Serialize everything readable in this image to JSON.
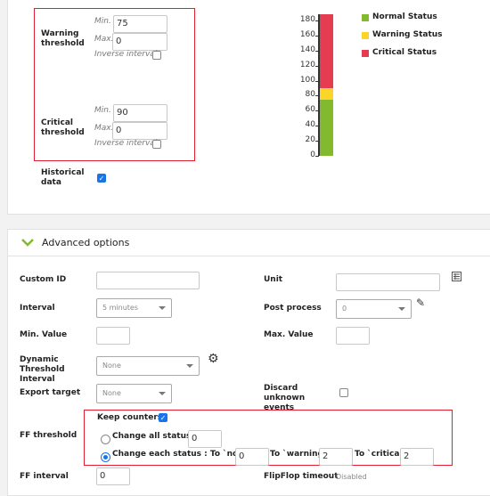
{
  "thresholds": {
    "warning": {
      "label": "Warning threshold",
      "min_label": "Min.",
      "min": "75",
      "max_label": "Max.",
      "max": "0",
      "inverse_label": "Inverse interval",
      "inverse": false
    },
    "critical": {
      "label": "Critical threshold",
      "min_label": "Min.",
      "min": "90",
      "max_label": "Max.",
      "max": "0",
      "inverse_label": "Inverse interval",
      "inverse": false
    },
    "historical_label": "Historical data",
    "historical": true
  },
  "chart_data": {
    "type": "bar",
    "stacked": true,
    "categories": [
      ""
    ],
    "series": [
      {
        "name": "Normal Status",
        "values": [
          75
        ],
        "color": "#82b92e"
      },
      {
        "name": "Warning Status",
        "values": [
          15
        ],
        "color": "#fcd52b"
      },
      {
        "name": "Critical Status",
        "values": [
          98
        ],
        "color": "#e63c52"
      }
    ],
    "yticks": [
      "0",
      "20",
      "40",
      "60",
      "80",
      "100",
      "120",
      "140",
      "160",
      "180"
    ],
    "ylim": [
      0,
      188
    ],
    "legend": "right"
  },
  "advanced": {
    "title": "Advanced options",
    "custom_id_label": "Custom ID",
    "custom_id": "",
    "unit_label": "Unit",
    "unit": "",
    "interval_label": "Interval",
    "interval": "5 minutes",
    "post_process_label": "Post process",
    "post_process": "0",
    "min_value_label": "Min. Value",
    "min_value": "",
    "max_value_label": "Max. Value",
    "max_value": "",
    "dynamic_label": "Dynamic Threshold Interval",
    "dynamic": "None",
    "export_label": "Export target",
    "export": "None",
    "discard_label": "Discard unknown events",
    "discard": false,
    "ff_threshold_label": "FF threshold",
    "keep_counters_label": "Keep counters",
    "keep_counters": true,
    "change_all_label": "Change all statuses :",
    "change_all": "0",
    "change_each_label": "Change each status : To `normal`",
    "to_normal": "0",
    "to_warning_label": "To `warning`",
    "to_warning": "2",
    "to_critical_label": "To `critical`",
    "to_critical": "2",
    "ff_interval_label": "FF interval",
    "ff_interval": "0",
    "flipflop_label": "FlipFlop timeout",
    "flipflop": "Disabled"
  }
}
